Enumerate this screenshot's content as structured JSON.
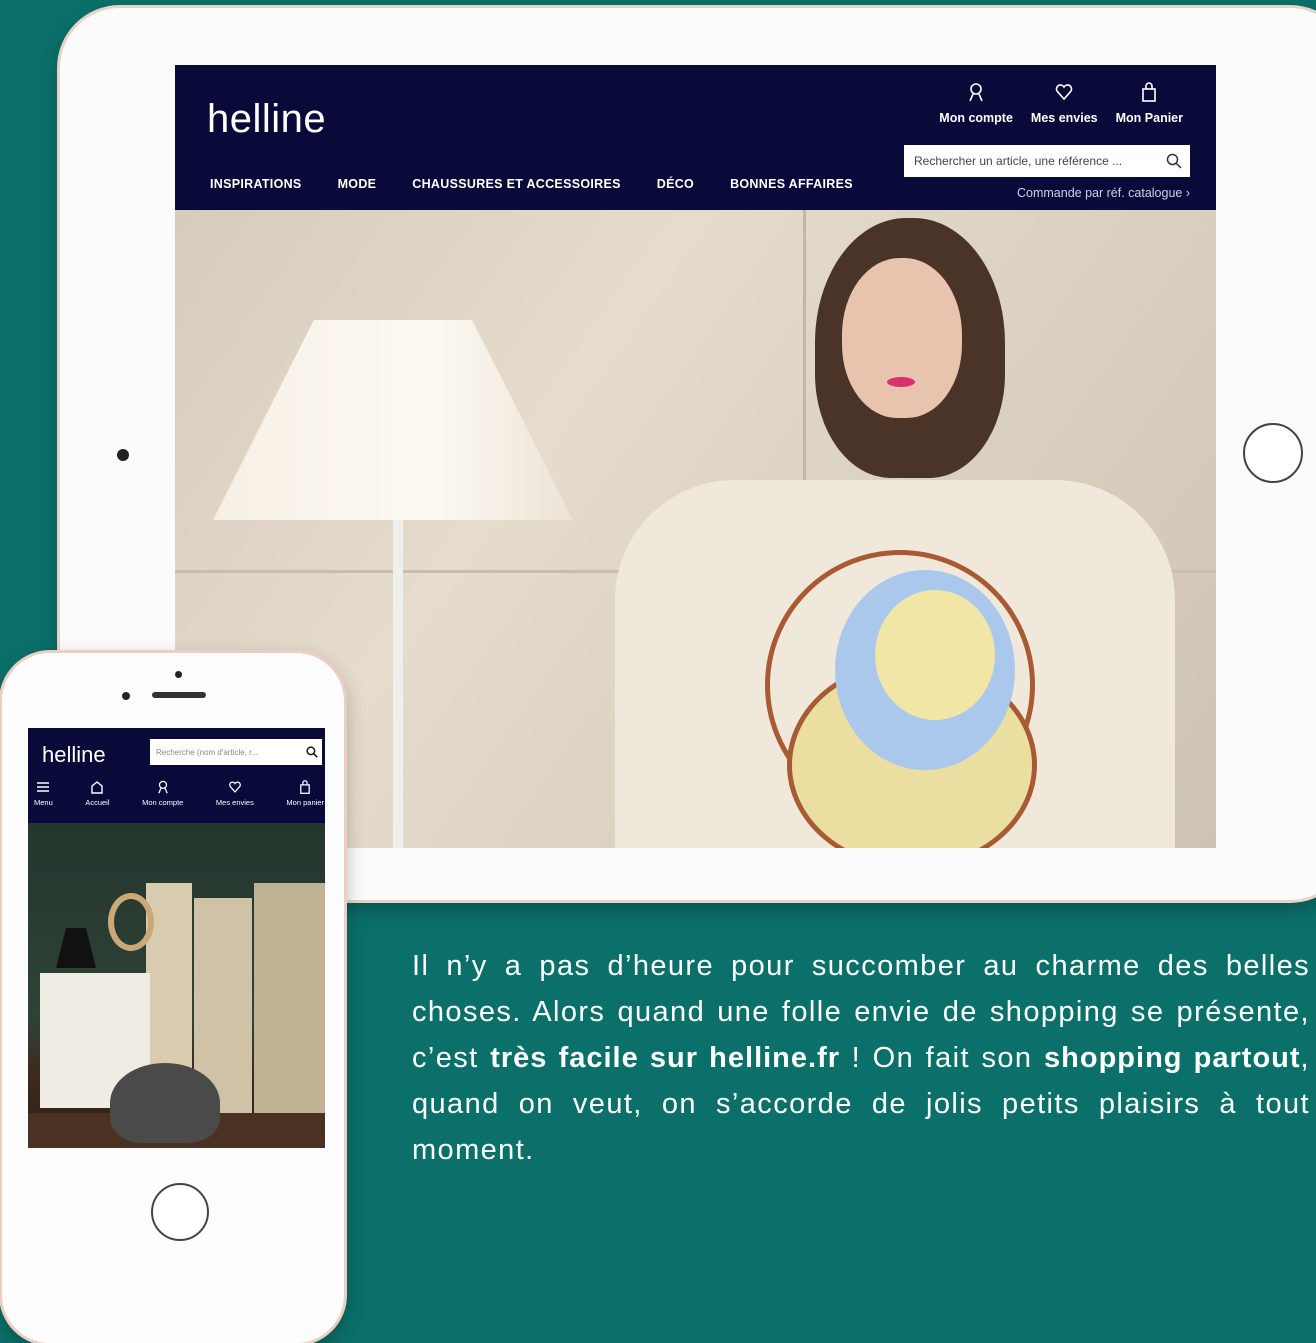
{
  "tablet": {
    "logo": "helline",
    "nav": [
      "INSPIRATIONS",
      "MODE",
      "CHAUSSURES ET ACCESSOIRES",
      "DÉCO",
      "BONNES AFFAIRES"
    ],
    "header_icons": [
      {
        "icon": "account-icon",
        "label": "Mon compte"
      },
      {
        "icon": "heart-icon",
        "label": "Mes envies"
      },
      {
        "icon": "bag-icon",
        "label": "Mon Panier"
      }
    ],
    "search": {
      "placeholder": "Rechercher un article, une référence ..."
    },
    "catalog_link": "Commande par réf. catalogue ›"
  },
  "phone": {
    "logo": "helline",
    "search": {
      "placeholder": "Recherche (nom d'article, r..."
    },
    "nav": [
      {
        "icon": "menu-icon",
        "label": "Menu"
      },
      {
        "icon": "home-icon",
        "label": "Accueil"
      },
      {
        "icon": "account-icon",
        "label": "Mon compte"
      },
      {
        "icon": "heart-icon",
        "label": "Mes envies"
      },
      {
        "icon": "bag-icon",
        "label": "Mon panier"
      }
    ]
  },
  "copy": {
    "part1": "Il n’y a pas d’heure pour succomber au charme des belles choses. Alors quand une folle envie de shopping se présente, c’est ",
    "bold1": "très facile sur helline.fr",
    "part2": " ! On fait son ",
    "bold2": "shopping partout",
    "part3": ", quand on veut, on s’accorde de jolis petits plaisirs à tout moment."
  },
  "colors": {
    "background": "#0b706a",
    "header": "#0a0a3a",
    "device": "#fbfbfb"
  }
}
